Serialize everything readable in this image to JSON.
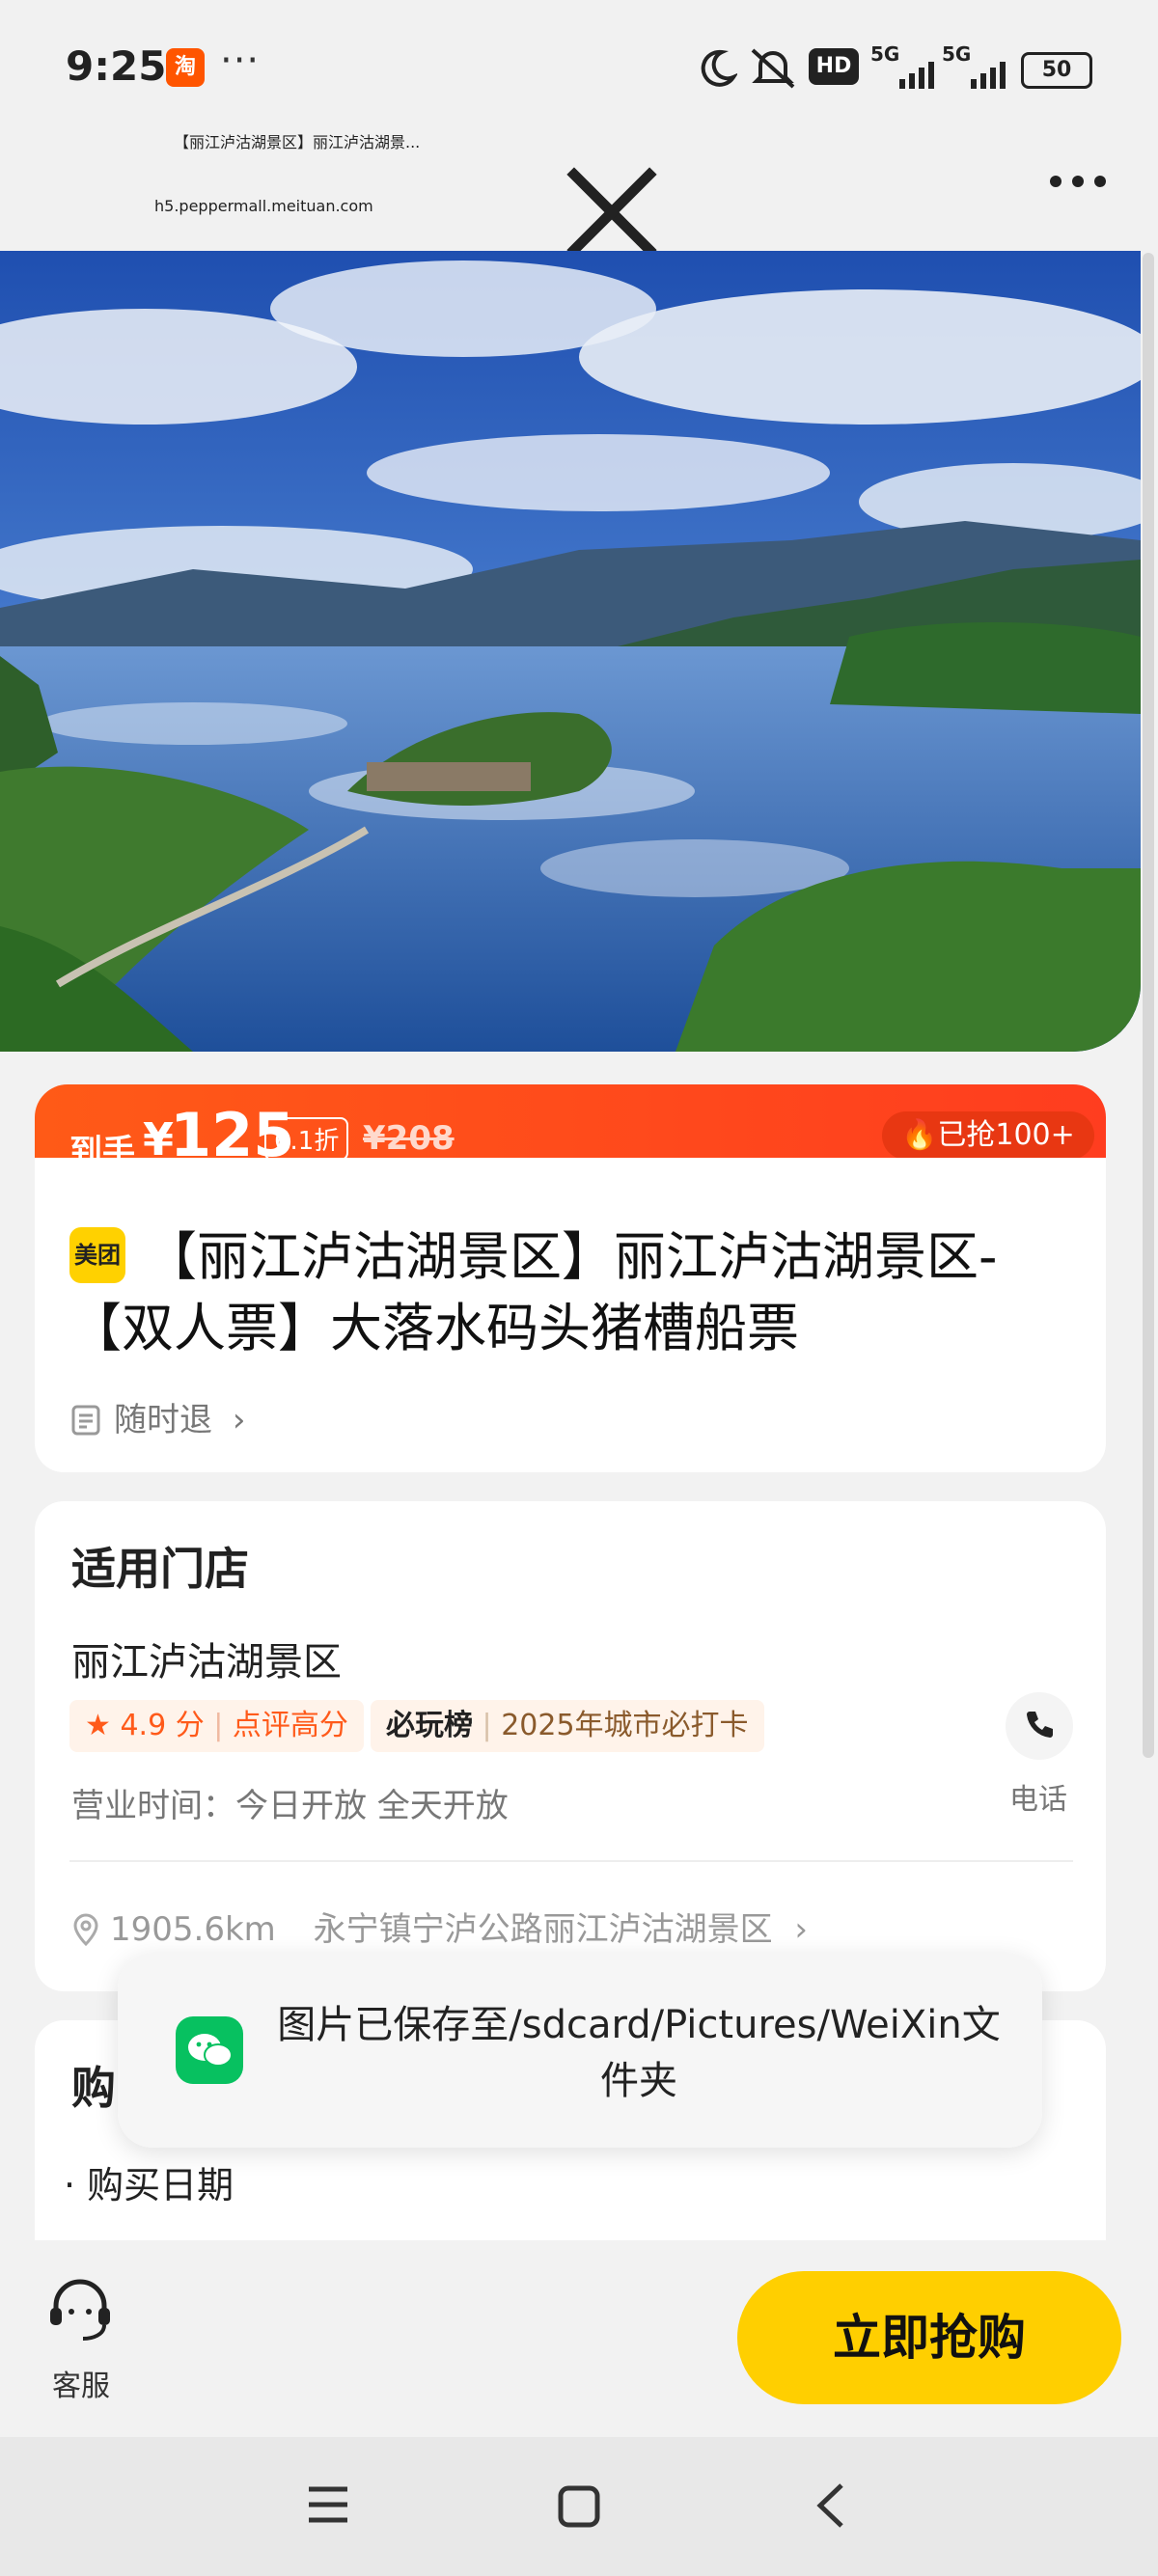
{
  "status_bar": {
    "time": "9:25",
    "app_badge": "淘",
    "more": "···",
    "hd": "HD",
    "sig1": "5G",
    "sig2": "5G",
    "battery": "50"
  },
  "nav": {
    "title": "【丽江泸沽湖景区】丽江泸沽湖景...",
    "url": "h5.peppermall.meituan.com"
  },
  "price_bar": {
    "prefix": "到手",
    "currency": "¥",
    "price": "125",
    "discount": "6.1折",
    "original": "¥208",
    "sold": "已抢100+"
  },
  "product": {
    "logo": "美团",
    "title": "【丽江泸沽湖景区】丽江泸沽湖景区-【双人票】大落水码头猪槽船票",
    "refund": "随时退"
  },
  "store": {
    "heading": "适用门店",
    "name": "丽江泸沽湖景区",
    "rating": "4.9 分",
    "rating_text": "点评高分",
    "rank_label": "必玩榜",
    "rank_text": "2025年城市必打卡",
    "hours_label": "营业时间：",
    "hours_value": "今日开放 全天开放",
    "phone_label": "电话",
    "distance": "1905.6km",
    "address": "永宁镇宁泸公路丽江泸沽湖景区"
  },
  "buy_info": {
    "heading": "购",
    "item": "购买日期"
  },
  "toast": {
    "message": "图片已保存至/sdcard/Pictures/WeiXin文件夹"
  },
  "bottom": {
    "service": "客服",
    "buy_now": "立即抢购"
  },
  "colors": {
    "accent": "#ff4a1a",
    "buy_button": "#ffcf00",
    "wechat": "#07c160"
  }
}
